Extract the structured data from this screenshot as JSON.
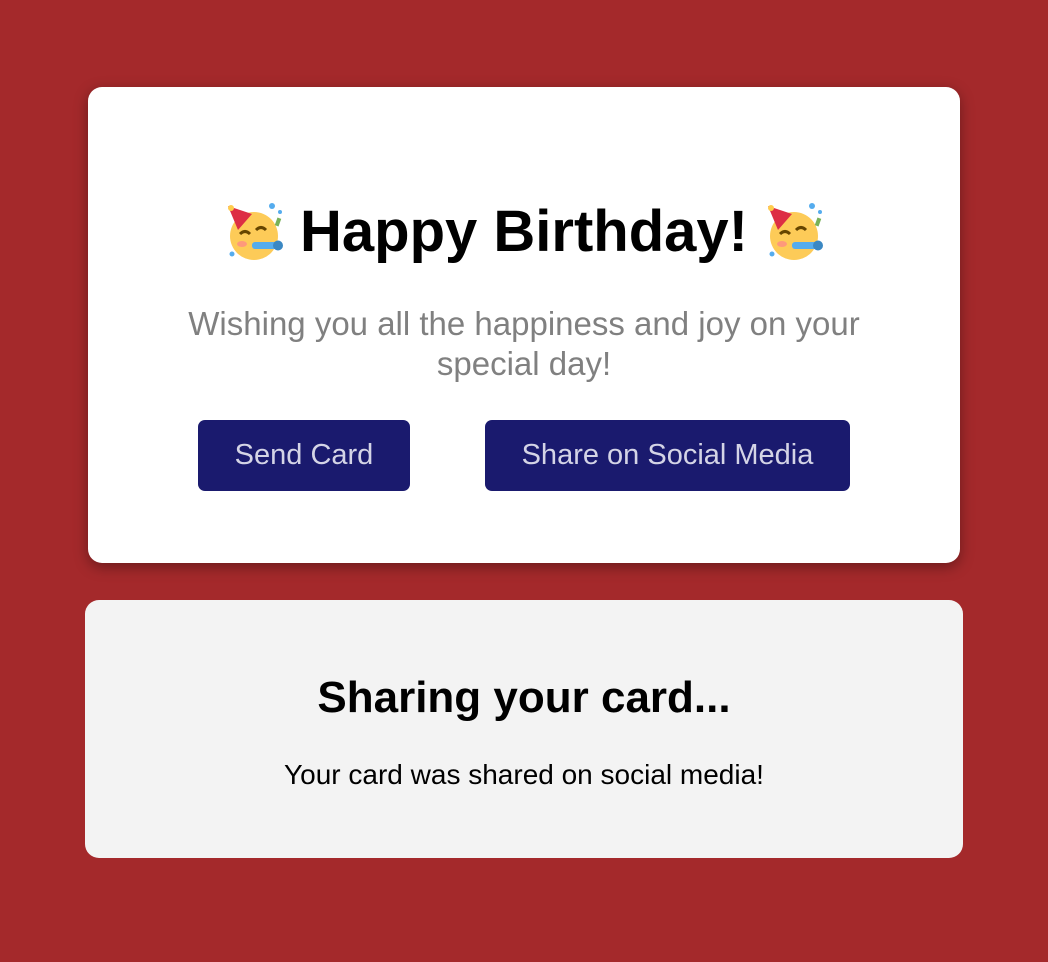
{
  "card": {
    "title": "Happy Birthday!",
    "title_icon": "partying-face-icon",
    "message": "Wishing you all the happiness and joy on your special day!",
    "buttons": {
      "send_label": "Send Card",
      "share_label": "Share on Social Media"
    }
  },
  "status": {
    "title": "Sharing your card...",
    "message": "Your card was shared on social media!"
  },
  "colors": {
    "background": "#a4292b",
    "button": "#1a1a6e",
    "button_text": "#d4d4e6",
    "subtitle": "#808080",
    "status_panel": "#f3f3f3"
  }
}
